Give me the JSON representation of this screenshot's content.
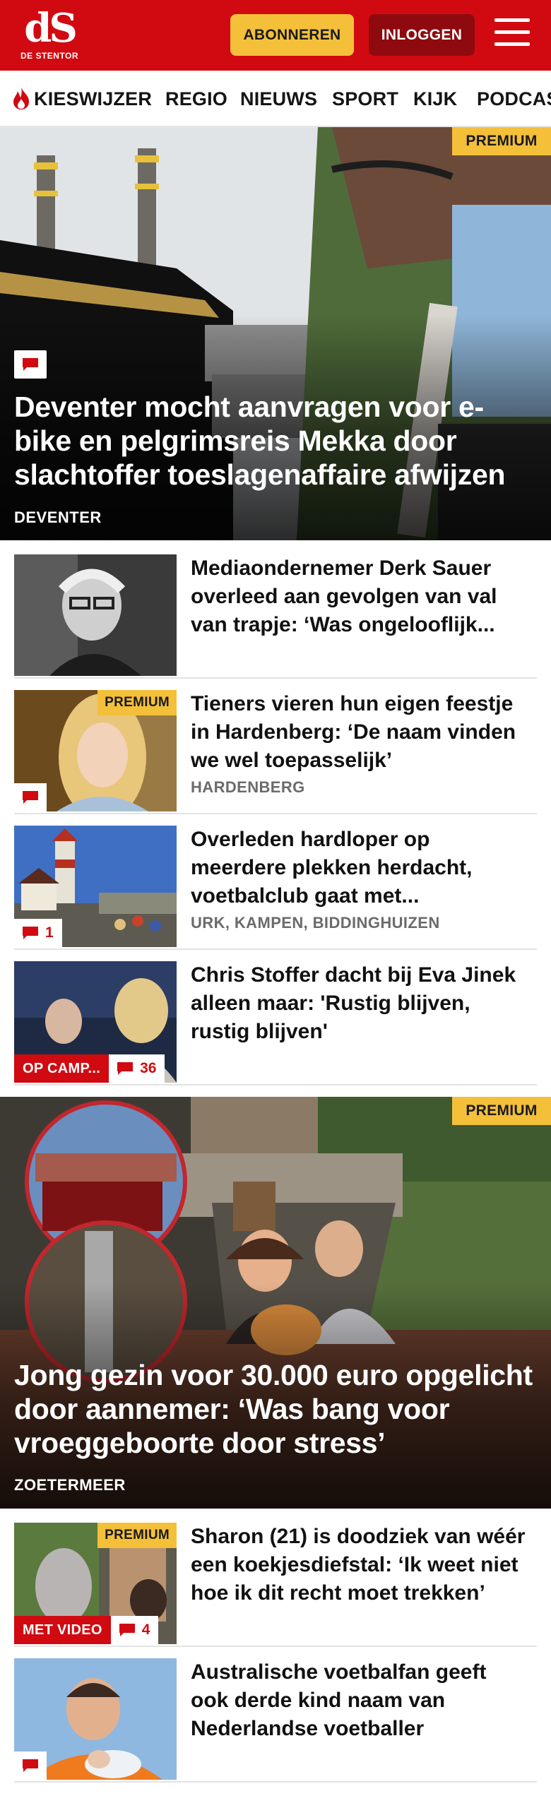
{
  "header": {
    "logo_mark": "dS",
    "logo_sub": "DE STENTOR",
    "subscribe_label": "ABONNEREN",
    "login_label": "INLOGGEN",
    "brand_color": "#d10a11",
    "accent_color": "#f4c03a"
  },
  "nav": {
    "items": [
      "KIESWIJZER",
      "REGIO",
      "NIEUWS",
      "SPORT",
      "KIJK",
      "PODCASTS"
    ]
  },
  "hero1": {
    "badge": "PREMIUM",
    "title": "Deventer mocht aanvragen voor e-bike en pelgrimsreis Mekka door slachtoffer toeslagenaffaire afwijzen",
    "location": "DEVENTER"
  },
  "articles": [
    {
      "title": "Mediaondernemer Derk Sauer overleed aan gevolgen van val van trapje: ‘Was ongelooflijk...",
      "location": "",
      "badge": "",
      "tag": "",
      "comments": ""
    },
    {
      "title": "Tieners vieren hun eigen feestje in Hardenberg: ‘De naam vinden we wel toepasselijk’",
      "location": "HARDENBERG",
      "badge": "PREMIUM",
      "tag": "",
      "comments": ""
    },
    {
      "title": "Overleden hardloper op meerdere plekken herdacht, voetbalclub gaat met...",
      "location": "URK, KAMPEN, BIDDINGHUIZEN",
      "badge": "",
      "tag": "",
      "comments": "1"
    },
    {
      "title": "Chris Stoffer dacht bij Eva Jinek alleen maar: 'Rustig blijven, rustig blijven'",
      "location": "",
      "badge": "",
      "tag": "OP CAMP...",
      "comments": "36"
    }
  ],
  "hero2": {
    "badge": "PREMIUM",
    "title": "Jong gezin voor 30.000 euro opgelicht door aannemer: ‘Was bang voor vroeggeboorte door stress’",
    "location": "ZOETERMEER"
  },
  "articles2": [
    {
      "title": "Sharon (21) is doodziek van wéér een koekjesdiefstal: ‘Ik weet niet hoe ik dit recht moet trekken’",
      "badge": "PREMIUM",
      "tag": "MET VIDEO",
      "comments": "4"
    },
    {
      "title": "Australische voetbalfan geeft ook derde kind naam van Nederlandse voetballer",
      "badge": "",
      "tag": "",
      "comments": ""
    }
  ]
}
